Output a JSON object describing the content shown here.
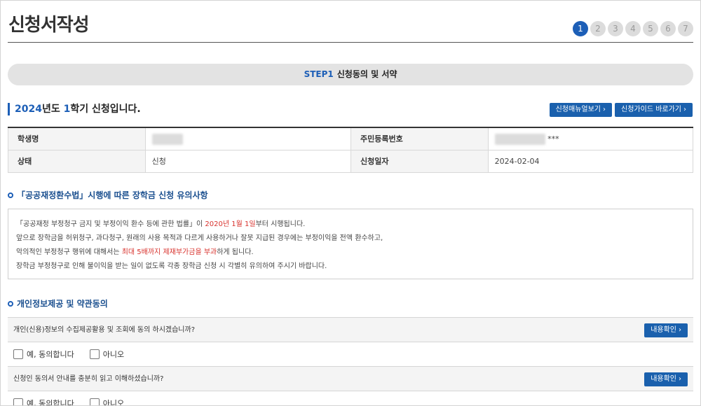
{
  "header": {
    "title": "신청서작성",
    "steps": [
      "1",
      "2",
      "3",
      "4",
      "5",
      "6",
      "7"
    ]
  },
  "banner": {
    "code": "STEP1",
    "label": "신청동의 및 서약"
  },
  "semester": {
    "year": "2024",
    "year_suffix": "년도 ",
    "term": "1",
    "term_suffix": "학기 신청입니다.",
    "buttons": {
      "manual": "신청매뉴얼보기",
      "guide": "신청가이드 바로가기"
    }
  },
  "applicant": {
    "name_label": "학생명",
    "rrn_label": "주민등록번호",
    "rrn_mask": "***",
    "status_label": "상태",
    "status_value": "신청",
    "date_label": "신청일자",
    "date_value": "2024-02-04"
  },
  "notice": {
    "heading": "「공공재정환수법」시행에 따른 장학금 신청 유의사항",
    "line1_a": "「공공재정 부정청구 금지 및 부정이익 환수 등에 관한 법률」이 ",
    "line1_red": "2020년 1월 1일",
    "line1_b": "부터 시행됩니다.",
    "line2": "앞으로 장학금을 허위청구, 과다청구, 원래의 사용 목적과 다르게 사용하거나 잘못 지급된 경우에는 부정이익을 전액 환수하고,",
    "line3_a": "악의적인 부정청구 행위에 대해서는 ",
    "line3_red": "최대 5배까지 제재부가금을 부과",
    "line3_b": "하게 됩니다.",
    "line4": "장학금 부정청구로 인해 불이익을 받는 일이 없도록 각종 장학금 신청 시 각별히 유의하여 주시기 바랍니다."
  },
  "consent": {
    "heading": "개인정보제공 및 약관동의",
    "view_label": "내용확인",
    "yes_label": "예, 동의합니다",
    "no_label": "아니오",
    "questions": [
      "개인(신용)정보의 수집제공활용 및 조회에 동의 하시겠습니까?",
      "신청인 동의서 안내를 충분히 읽고 이해하셨습니까?"
    ]
  },
  "colors": {
    "accent": "#1d5fb7",
    "button": "#1a60ad",
    "warning": "#d8322d"
  },
  "icons": {
    "button_arrow": "chevron-right-icon",
    "section_bullet": "circle-bullet-icon"
  }
}
